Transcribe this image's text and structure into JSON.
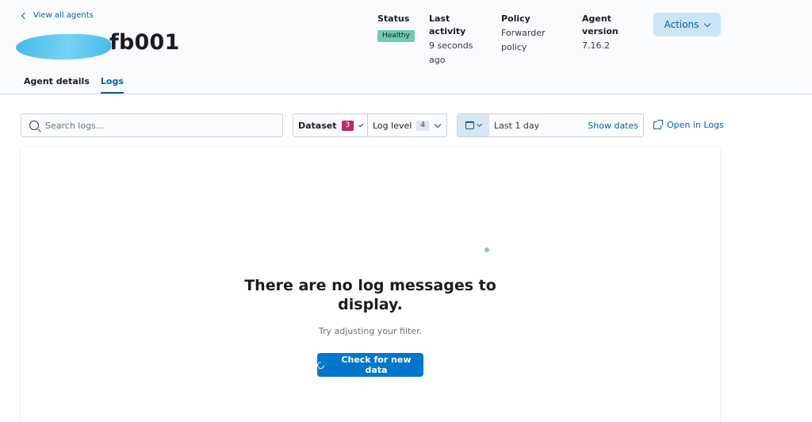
{
  "header": {
    "back_link": "View all agents",
    "agent_name": "fb001",
    "status": {
      "label": "Status",
      "value": "Healthy",
      "color": "#6dccb1"
    },
    "last_activity": {
      "label": "Last activity",
      "value": "9 seconds ago"
    },
    "policy": {
      "label": "Policy",
      "value": "Forwarder policy"
    },
    "agent_version": {
      "label": "Agent version",
      "value": "7.16.2"
    },
    "actions_label": "Actions"
  },
  "tabs": [
    {
      "label": "Agent details",
      "active": false
    },
    {
      "label": "Logs",
      "active": true
    }
  ],
  "toolbar": {
    "search_placeholder": "Search logs...",
    "dataset": {
      "label": "Dataset",
      "count": "3"
    },
    "log_level": {
      "label": "Log level",
      "count": "4"
    },
    "date_range": "Last 1 day",
    "show_dates": "Show dates",
    "open_in_logs": "Open in Logs"
  },
  "empty_state": {
    "title": "There are no log messages to display.",
    "subtitle": "Try adjusting your filter.",
    "button": "Check for new data"
  },
  "colors": {
    "accent": "#0077cc",
    "link": "#0061a6",
    "dataset_badge": "#bd2767"
  }
}
